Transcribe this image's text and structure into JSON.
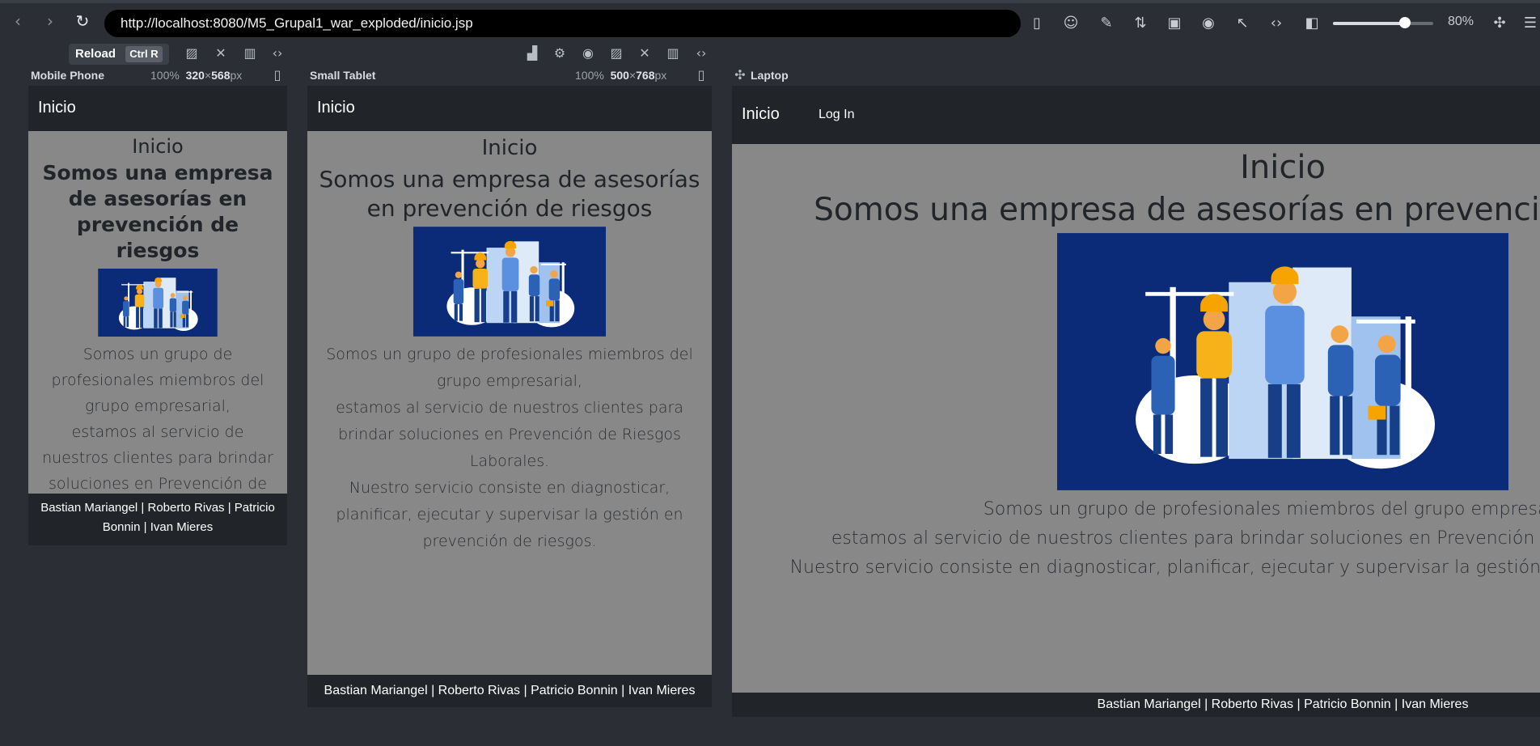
{
  "browser": {
    "url": "http://localhost:8080/M5_Grupal1_war_exploded/inicio.jsp",
    "zoom": "80%",
    "tooltip_label": "Reload",
    "tooltip_shortcut": "Ctrl R"
  },
  "devices": {
    "mobile": {
      "label": "Mobile Phone",
      "scale": "100%",
      "width": "320",
      "height": "568",
      "unit": "px"
    },
    "tablet": {
      "label": "Small Tablet",
      "scale": "100%",
      "width": "500",
      "height": "768",
      "unit": "px"
    },
    "laptop": {
      "label": "Laptop"
    }
  },
  "site": {
    "nav_brand": "Inicio",
    "nav_login": "Log In",
    "heading": "Inicio",
    "subheading": "Somos una empresa de asesorías en prevención de riesgos",
    "para1": "Somos un grupo de profesionales miembros del grupo empresarial,",
    "para2": "estamos al servicio de nuestros clientes para brindar soluciones en Prevención de Riesgos Laborales.",
    "para3": "Nuestro servicio consiste en diagnosticar, planificar, ejecutar y supervisar la gestión en prevención de riesgos.",
    "footer": "Bastian Mariangel | Roberto Rivas | Patricio Bonnin | Ivan Mieres"
  },
  "icons": [
    "back-icon",
    "forward-icon",
    "reload-icon",
    "layout-icon",
    "user-icon",
    "pen-icon",
    "sort-icon",
    "viewport-icon",
    "camera-icon",
    "inspect-icon",
    "code-icon",
    "sidebar-icon",
    "extensions-icon"
  ]
}
